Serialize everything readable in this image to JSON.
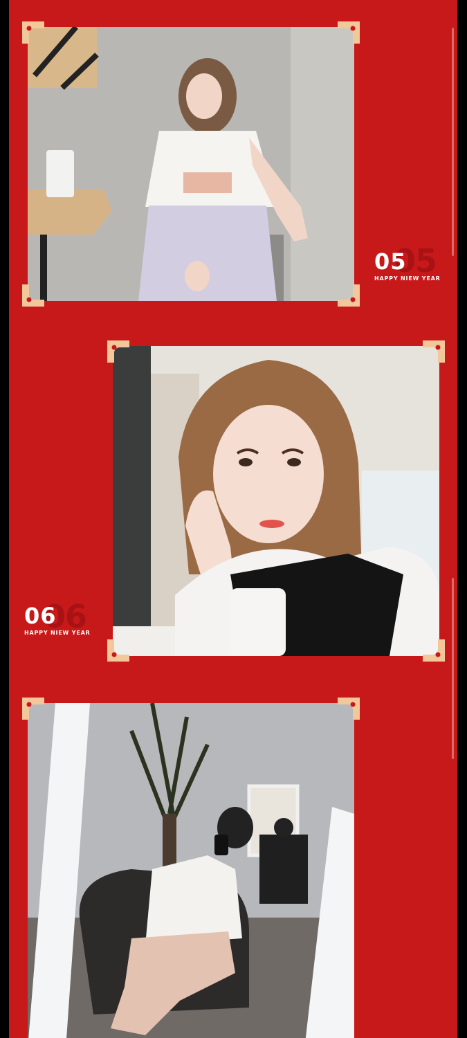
{
  "colors": {
    "background": "#c8191a",
    "page_edge": "#000000",
    "corner_ornament": "#f2c79a",
    "badge_text": "#ffffff",
    "badge_ghost": "#a81214"
  },
  "entries": [
    {
      "number": "05",
      "caption": "HAPPY NIEW YEAR",
      "photo": "girl-seated-white-tshirt-plaid-skirt"
    },
    {
      "number": "06",
      "caption": "HAPPY NIEW YEAR",
      "photo": "girl-closeup-hand-on-cheek"
    },
    {
      "photo": "girl-mirror-selfie-salon-chair"
    }
  ]
}
